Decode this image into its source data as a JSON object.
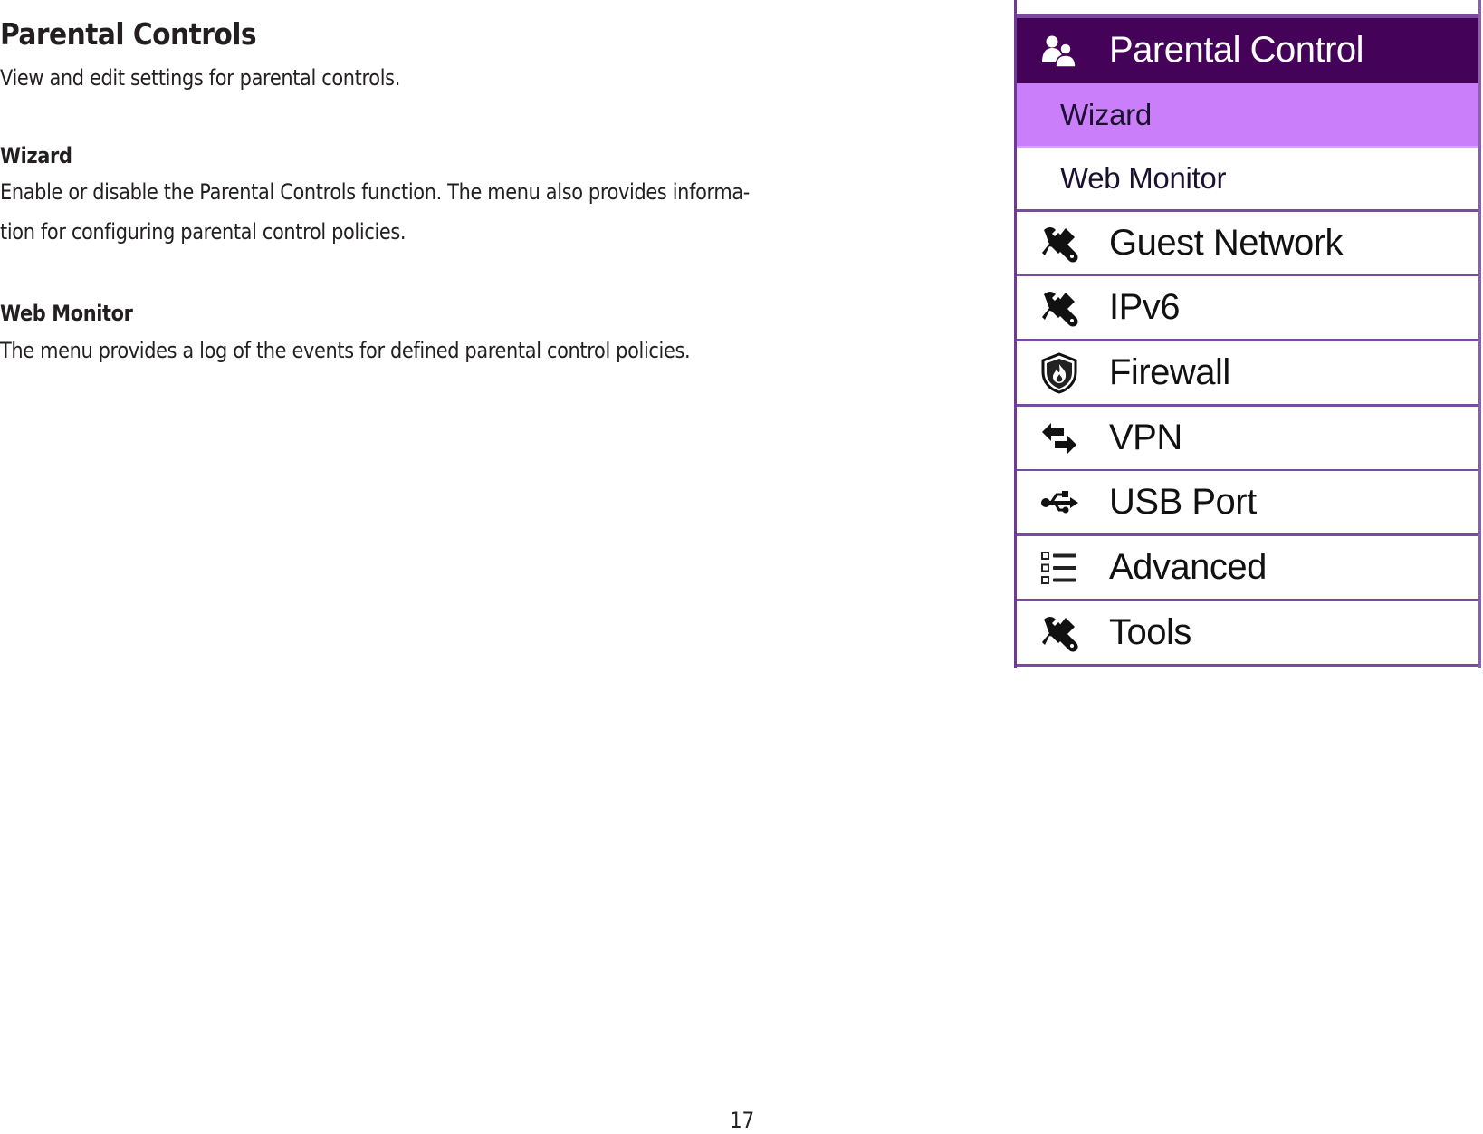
{
  "document": {
    "title": "Parental Controls",
    "intro": "View and edit settings for parental controls.",
    "sections": [
      {
        "heading": "Wizard",
        "lines": [
          "Enable or disable the Parental Controls function. The menu also provides informa-",
          "tion for configuring parental control policies."
        ]
      },
      {
        "heading": "Web Monitor",
        "lines": [
          "The menu provides a log of the events for defined parental control policies."
        ]
      }
    ],
    "page_number": "17"
  },
  "menu": {
    "colors": {
      "header_bg": "#440258",
      "active_sub_bg": "#cb7ef9",
      "border": "#7a4aa0"
    },
    "header": {
      "label": "Parental Control",
      "icon": "users-icon"
    },
    "submenu": [
      {
        "label": "Wizard",
        "active": true
      },
      {
        "label": "Web Monitor",
        "active": false
      }
    ],
    "items": [
      {
        "label": "Guest Network",
        "icon": "tools-icon"
      },
      {
        "label": "IPv6",
        "icon": "tools-icon"
      },
      {
        "label": "Firewall",
        "icon": "firewall-shield-icon"
      },
      {
        "label": "VPN",
        "icon": "exchange-arrows-icon"
      },
      {
        "label": "USB Port",
        "icon": "usb-icon"
      },
      {
        "label": "Advanced",
        "icon": "list-icon"
      },
      {
        "label": "Tools",
        "icon": "tools-icon"
      }
    ]
  }
}
